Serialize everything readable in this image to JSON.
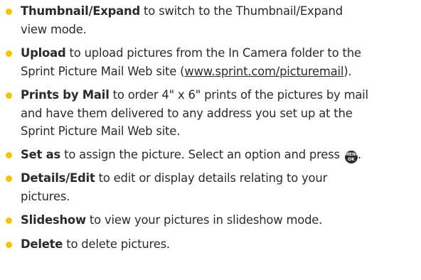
{
  "colors": {
    "bullet": "#f5c400",
    "text": "#2b2b2b"
  },
  "items": [
    {
      "term": "Thumbnail/Expand",
      "desc": " to switch to the Thumbnail/Expand\nview mode."
    },
    {
      "term": "Upload",
      "desc": " to upload pictures from the In Camera folder to the\nSprint Picture Mail Web site (",
      "link": "www.sprint.com/picturemail",
      "after": ")."
    },
    {
      "term": "Prints by Mail",
      "desc": " to order 4\" x 6\" prints of the pictures by mail\nand have them delivered to any address you set up at the\nSprint Picture Mail Web site."
    },
    {
      "term": "Set as",
      "desc": " to assign the picture. Select an option and press ",
      "icon": "menu-ok-key-icon",
      "icon_top": "MENU",
      "icon_bottom": "OK",
      "after": "."
    },
    {
      "term": "Details/Edit",
      "desc": " to edit or display details relating to your\npictures."
    },
    {
      "term": "Slideshow",
      "desc": " to view your pictures in slideshow mode."
    },
    {
      "term": "Delete",
      "desc": " to delete pictures."
    }
  ]
}
